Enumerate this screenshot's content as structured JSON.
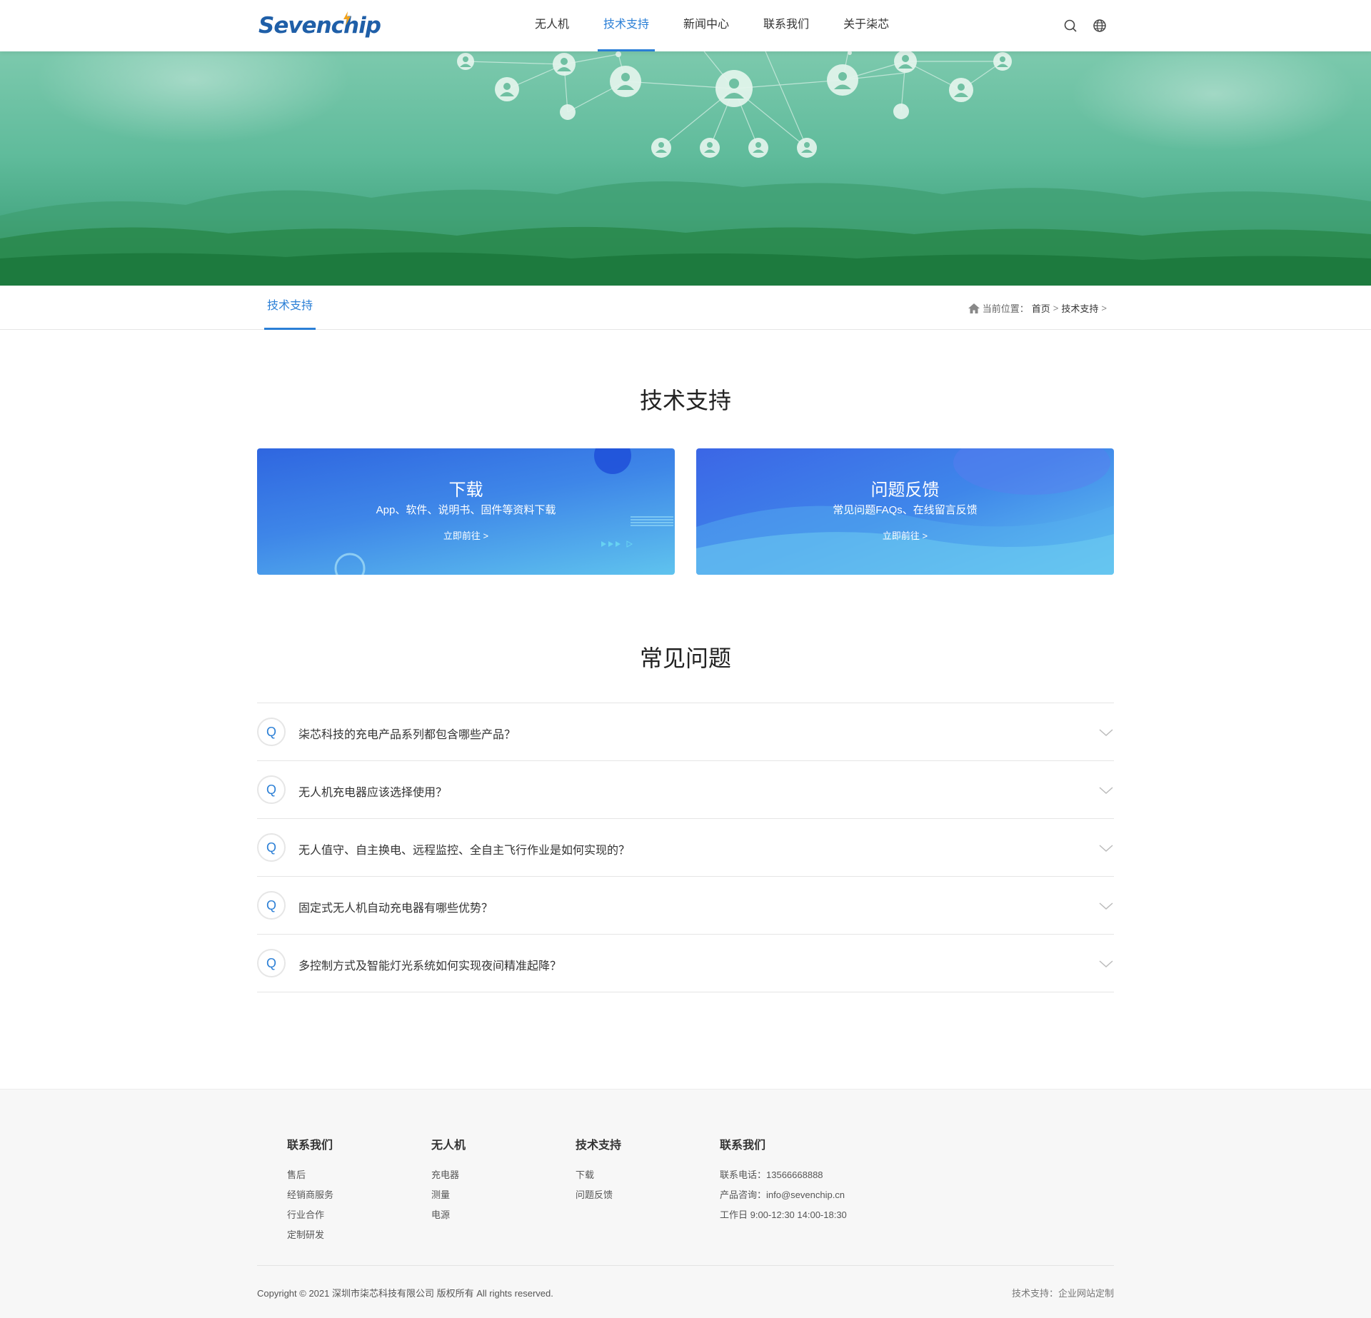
{
  "header": {
    "logo_text": "Sevenchip",
    "nav": [
      {
        "label": "无人机",
        "active": false
      },
      {
        "label": "技术支持",
        "active": true
      },
      {
        "label": "新闻中心",
        "active": false
      },
      {
        "label": "联系我们",
        "active": false
      },
      {
        "label": "关于柒芯",
        "active": false
      }
    ],
    "icons": [
      "search-icon",
      "globe-icon"
    ]
  },
  "subnav": {
    "tab": "技术支持",
    "breadcrumb": {
      "prefix": "当前位置：",
      "home": "首页",
      "sep": ">",
      "current": "技术支持"
    }
  },
  "support": {
    "title": "技术支持",
    "cards": [
      {
        "title": "下载",
        "desc": "App、软件、说明书、固件等资料下载",
        "link": "立即前往 >"
      },
      {
        "title": "问题反馈",
        "desc": "常见问题FAQs、在线留言反馈",
        "link": "立即前往 >"
      }
    ]
  },
  "faq": {
    "title": "常见问题",
    "marker": "Q",
    "items": [
      "柒芯科技的充电产品系列都包含哪些产品？",
      "无人机充电器应该选择使用？",
      "无人值守、自主换电、远程监控、全自主飞行作业是如何实现的？",
      "固定式无人机自动充电器有哪些优势？",
      "多控制方式及智能灯光系统如何实现夜间精准起降？"
    ]
  },
  "footer": {
    "columns": [
      {
        "title": "联系我们",
        "links": [
          "售后",
          "经销商服务",
          "行业合作",
          "定制研发"
        ]
      },
      {
        "title": "无人机",
        "links": [
          "充电器",
          "测量",
          "电源"
        ]
      },
      {
        "title": "技术支持",
        "links": [
          "下载",
          "问题反馈"
        ]
      },
      {
        "title": "联系我们",
        "links": [
          "联系电话：13566668888",
          "产品咨询：info@sevenchip.cn",
          "工作日 9:00-12:30 14:00-18:30"
        ]
      }
    ],
    "copyright": "Copyright © 2021 深圳市柒芯科技有限公司 版权所有 All rights reserved.",
    "tech_support": "技术支持：企业网站定制"
  },
  "colors": {
    "accent": "#2b7fd6",
    "brand": "#1f5fa8",
    "banner_green": "#5fbb9b"
  }
}
